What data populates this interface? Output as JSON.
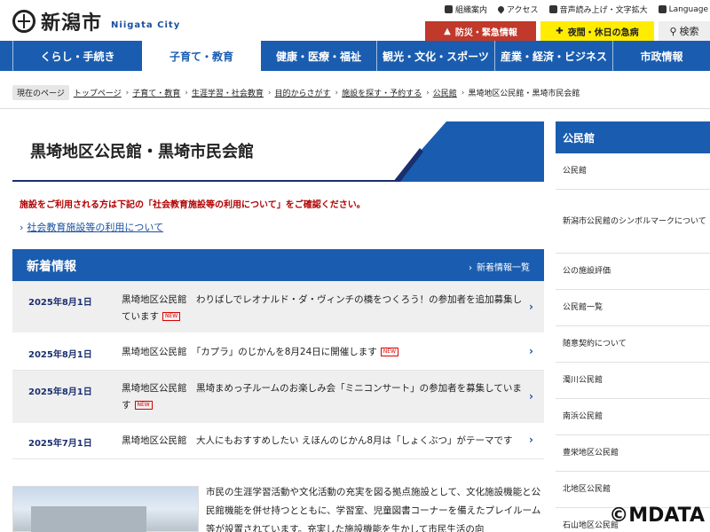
{
  "header": {
    "logo_text": "新潟市",
    "logo_en": "Niigata City",
    "util": {
      "org": "組織案内",
      "access": "アクセス",
      "voice": "音声読み上げ・文字拡大",
      "language": "Language"
    },
    "emergency_label": "防災・緊急情報",
    "night_label": "夜間・休日の急病",
    "search_label": "検索"
  },
  "nav": {
    "items": [
      {
        "label": "くらし・手続き"
      },
      {
        "label": "子育て・教育"
      },
      {
        "label": "健康・医療・福祉"
      },
      {
        "label": "観光・文化・スポーツ"
      },
      {
        "label": "産業・経済・ビジネス"
      },
      {
        "label": "市政情報"
      }
    ]
  },
  "breadcrumb": {
    "here_label": "現在のページ",
    "crumbs": [
      {
        "label": "トップページ"
      },
      {
        "label": "子育て・教育"
      },
      {
        "label": "生涯学習・社会教育"
      },
      {
        "label": "目的からさがす"
      },
      {
        "label": "施設を探す・予約する"
      },
      {
        "label": "公民館"
      }
    ],
    "current": "黒埼地区公民館・黒埼市民会館"
  },
  "page": {
    "title": "黒埼地区公民館・黒埼市民会館",
    "notice": "施設をご利用される方は下記の「社会教育施設等の利用について」をご確認ください。",
    "link": "社会教育施設等の利用について"
  },
  "news": {
    "heading": "新着情報",
    "all_label": "新着情報一覧",
    "new_badge": "NEW",
    "items": [
      {
        "date": "2025年8月1日",
        "text": "黒埼地区公民館　わりばしでレオナルド・ダ・ヴィンチの橋をつくろう！の参加者を追加募集しています",
        "new": true
      },
      {
        "date": "2025年8月1日",
        "text": "黒埼地区公民館　「カプラ」のじかんを8月24日に開催します",
        "new": true
      },
      {
        "date": "2025年8月1日",
        "text": "黒埼地区公民館　黒埼まめっ子ルームのお楽しみ会「ミニコンサート」の参加者を募集しています",
        "new": true
      },
      {
        "date": "2025年7月1日",
        "text": "黒埼地区公民館　大人にもおすすめしたい えほんのじかん8月は「しょくぶつ」がテーマです",
        "new": false
      }
    ]
  },
  "intro": "市民の生涯学習活動や文化活動の充実を図る拠点施設として、文化施設機能と公民館機能を併せ持つとともに、学習室、児童図書コーナーを備えたプレイルーム等が設置されています。充実した施設機能を生かして市民生活の向",
  "sidebar": {
    "heading": "公民館",
    "items": [
      {
        "label": "公民館"
      },
      {
        "label": "新潟市公民館のシンボルマークについて"
      },
      {
        "label": "公の施設評価"
      },
      {
        "label": "公民館一覧"
      },
      {
        "label": "随意契約について"
      },
      {
        "label": "濁川公民館"
      },
      {
        "label": "南浜公民館"
      },
      {
        "label": "豊栄地区公民館"
      },
      {
        "label": "北地区公民館"
      },
      {
        "label": "石山地区公民館"
      }
    ]
  },
  "watermark": "©MDATA",
  "colors": {
    "primary": "#1a5db0",
    "navy": "#1a2f6e",
    "emergency": "#c0392b",
    "night": "#ffec00",
    "notice": "#b00000"
  }
}
